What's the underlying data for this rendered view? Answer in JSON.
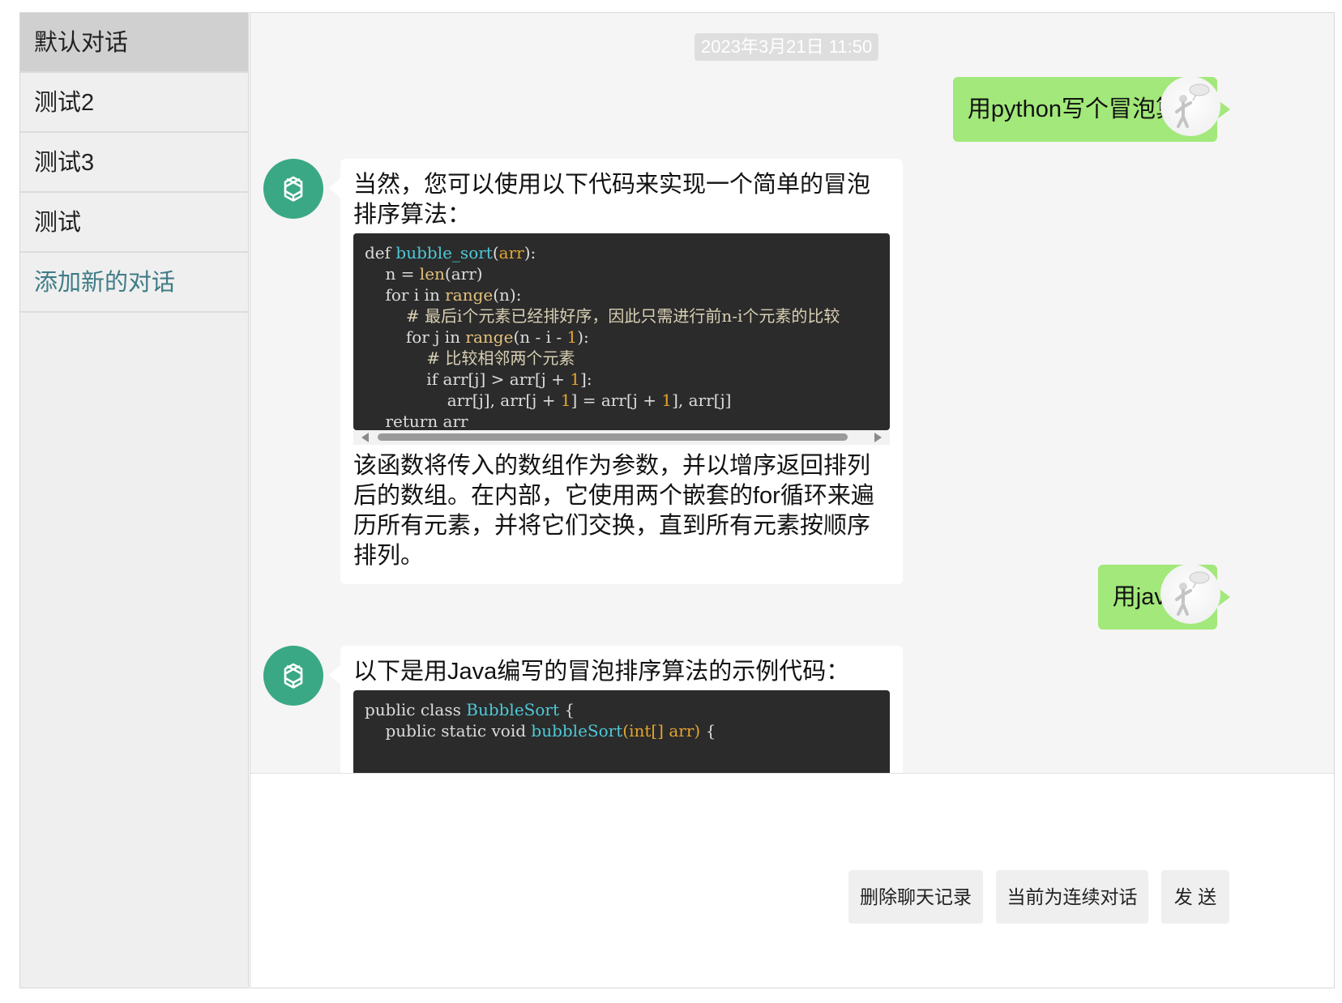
{
  "sidebar": {
    "items": [
      {
        "label": "默认对话"
      },
      {
        "label": "测试2"
      },
      {
        "label": "测试3"
      },
      {
        "label": "测试"
      },
      {
        "label": "添加新的对话"
      }
    ]
  },
  "chat": {
    "timestamp": "2023年3月21日 11:50",
    "msg1_user": "用python写个冒泡算法",
    "msg2_bot_intro": "当然，您可以使用以下代码来实现一个简单的冒泡排序算法：",
    "msg2_bot_outro": "该函数将传入的数组作为参数，并以增序返回排列后的数组。在内部，它使用两个嵌套的for循环来遍历所有元素，并将它们交换，直到所有元素按顺序排列。",
    "msg3_user": "用java呢",
    "msg4_bot_intro": "以下是用Java编写的冒泡排序算法的示例代码："
  },
  "code_python": {
    "l1_def": "def",
    "l1_fn": "bubble_sort",
    "l1_param": "arr",
    "l2_n": "n =",
    "l2_len": "len",
    "l2_arg": "(arr)",
    "l3_for": "for i in",
    "l3_range": "range",
    "l3_arg": "(n):",
    "l4_comment": "# 最后i个元素已经排好序，因此只需进行前n-i个元素的比较",
    "l5_for": "for j in",
    "l5_range": "range",
    "l5_arg": "(n - i - ",
    "l5_num": "1",
    "l5_end": "):",
    "l6_comment": "# 比较相邻两个元素",
    "l7_if": "if arr[j] > arr[j + ",
    "l7_num": "1",
    "l7_end": "]:",
    "l8_a": "arr[j], arr[j + ",
    "l8_num1": "1",
    "l8_b": "] = arr[j + ",
    "l8_num2": "1",
    "l8_c": "], arr[j]",
    "l9_return": "return arr"
  },
  "code_java": {
    "l1_kw": "public class",
    "l1_cls": "BubbleSort",
    "l1_brace": "{",
    "l2_kw": "public static void",
    "l2_fn": "bubbleSort",
    "l2_params": "(int[] arr)",
    "l2_brace": "{"
  },
  "buttons": {
    "delete_history": "删除聊天记录",
    "continuous_mode": "当前为连续对话",
    "send": "发 送"
  },
  "colors": {
    "user_bubble": "#a2e87a",
    "bot_avatar": "#3aa885",
    "code_bg": "#2b2b2b",
    "sidebar_active": "#d0d0d0",
    "add_link": "#3f7c86"
  }
}
